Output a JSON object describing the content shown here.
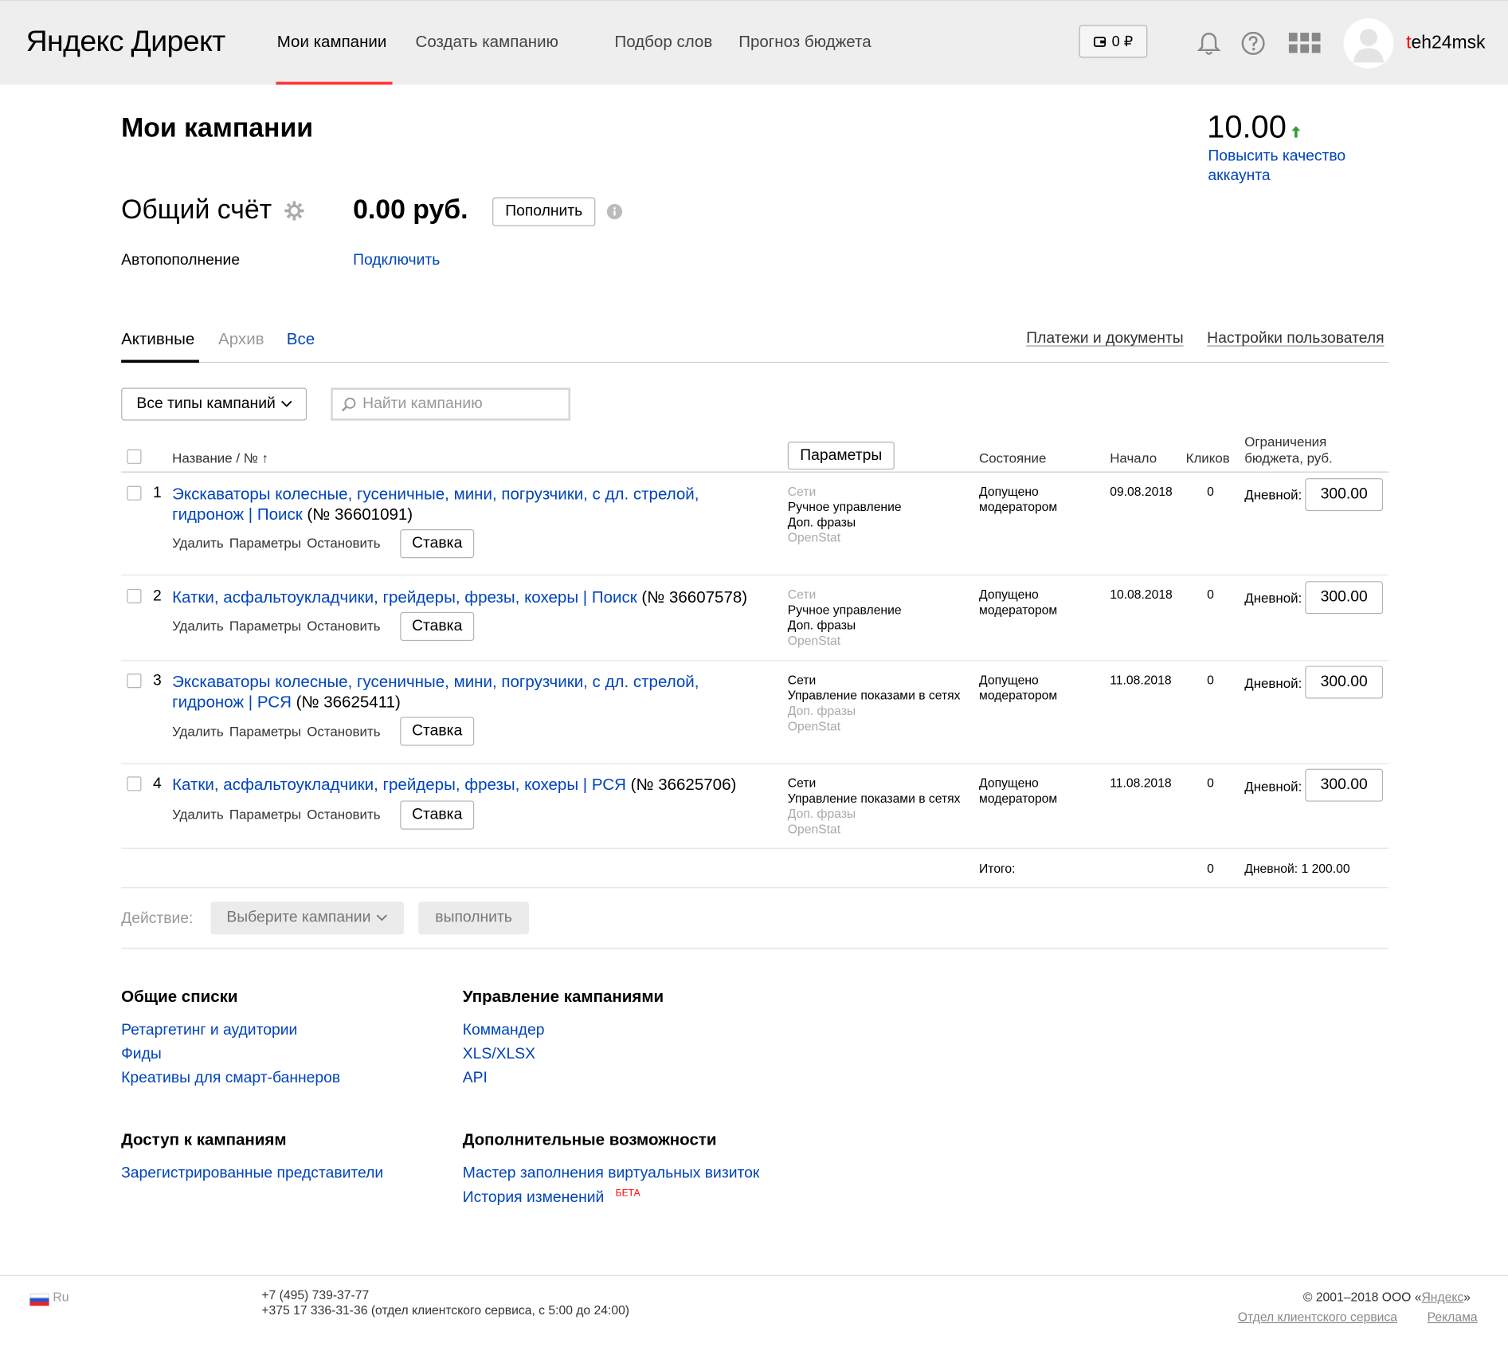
{
  "header": {
    "logo_ya": "Яндекс",
    "logo_direct": "Директ",
    "nav": [
      "Мои кампании",
      "Создать кампанию",
      "Подбор слов",
      "Прогноз бюджета"
    ],
    "wallet": "0 ₽",
    "username_first": "t",
    "username_rest": "eh24msk"
  },
  "page": {
    "title": "Мои кампании",
    "quality_score": "10.00",
    "quality_link": "Повысить качество аккаунта"
  },
  "account": {
    "title": "Общий счёт",
    "sum": "0.00 руб.",
    "topup_button": "Пополнить",
    "auto_label": "Автопополнение",
    "auto_link": "Подключить"
  },
  "tabs": {
    "active": "Активные",
    "archive": "Архив",
    "all": "Все",
    "payments": "Платежи и документы",
    "settings": "Настройки пользователя"
  },
  "filters": {
    "type_select": "Все типы кампаний",
    "search_placeholder": "Найти кампанию"
  },
  "table": {
    "col_name": "Название / № ↑",
    "params_button": "Параметры",
    "col_state": "Состояние",
    "col_start": "Начало",
    "col_clicks": "Кликов",
    "col_budget_1": "Ограничения",
    "col_budget_2": "бюджета, руб.",
    "row_actions": [
      "Удалить",
      "Параметры",
      "Остановить"
    ],
    "bid_button": "Ставка",
    "budget_label": "Дневной:",
    "rows": [
      {
        "n": "1",
        "name_1": "Экскаваторы колесные, гусеничные, мини, погрузчики, с дл. стрелой,",
        "name_2": "гидронож | Поиск",
        "num": " (№ 36601091)",
        "p1": "Сети",
        "p2": "Ручное управление",
        "p3": "Доп. фразы",
        "p4": "OpenStat",
        "state_1": "Допущено",
        "state_2": "модератором",
        "start": "09.08.2018",
        "clicks": "0",
        "budget": "300.00"
      },
      {
        "n": "2",
        "name_1": "Катки, асфальтоукладчики, грейдеры, фрезы, кохеры | Поиск",
        "name_2": "",
        "num": " (№ 36607578)",
        "p1": "Сети",
        "p2": "Ручное управление",
        "p3": "Доп. фразы",
        "p4": "OpenStat",
        "state_1": "Допущено",
        "state_2": "модератором",
        "start": "10.08.2018",
        "clicks": "0",
        "budget": "300.00"
      },
      {
        "n": "3",
        "name_1": "Экскаваторы колесные, гусеничные, мини, погрузчики, с дл. стрелой,",
        "name_2": "гидронож | РСЯ",
        "num": " (№ 36625411)",
        "p1": "Сети",
        "p2": "Управление показами в сетях",
        "p3": "Доп. фразы",
        "p4": "OpenStat",
        "state_1": "Допущено",
        "state_2": "модератором",
        "start": "11.08.2018",
        "clicks": "0",
        "budget": "300.00"
      },
      {
        "n": "4",
        "name_1": "Катки, асфальтоукладчики, грейдеры, фрезы, кохеры | РСЯ",
        "name_2": "",
        "num": " (№ 36625706)",
        "p1": "Сети",
        "p2": "Управление показами в сетях",
        "p3": "Доп. фразы",
        "p4": "OpenStat",
        "state_1": "Допущено",
        "state_2": "модератором",
        "start": "11.08.2018",
        "clicks": "0",
        "budget": "300.00"
      }
    ],
    "total_label": "Итого:",
    "total_clicks": "0",
    "total_budget": "Дневной: 1 200.00"
  },
  "actions": {
    "label": "Действие:",
    "select": "Выберите кампании",
    "run": "выполнить"
  },
  "sections": {
    "lists_title": "Общие списки",
    "lists": [
      "Ретаргетинг и аудитории",
      "Фиды",
      "Креативы для смарт-баннеров"
    ],
    "manage_title": "Управление кампаниями",
    "manage": [
      "Коммандер",
      "XLS/XLSX",
      "API"
    ],
    "access_title": "Доступ к кампаниям",
    "access": [
      "Зарегистрированные представители"
    ],
    "extra_title": "Дополнительные возможности",
    "extra": [
      "Мастер заполнения виртуальных визиток",
      "История изменений"
    ],
    "beta": "БЕТА"
  },
  "footer": {
    "lang": "Ru",
    "phone_1": "+7 (495) 739-37-77",
    "phone_2": "+375 17 336-31-36 (отдел клиентского сервиса, с 5:00 до 24:00)",
    "copyright_prefix": "© 2001–2018 ООО «",
    "copyright_link": "Яндекс",
    "copyright_suffix": "»",
    "support_link": "Отдел клиентского сервиса",
    "ads_link": "Реклама"
  }
}
